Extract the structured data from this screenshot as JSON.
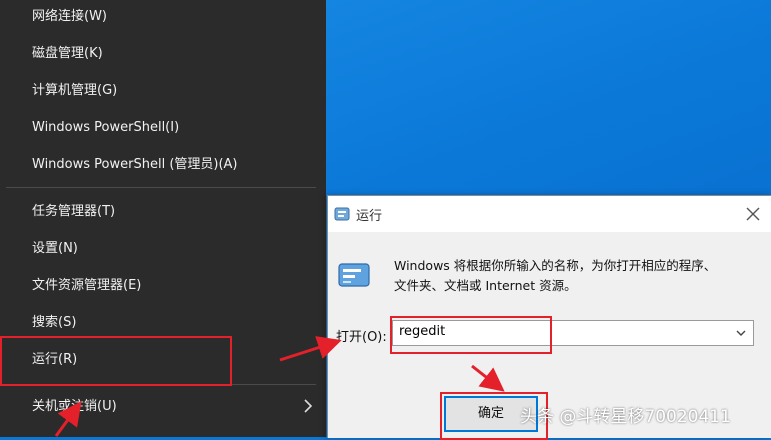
{
  "winx_menu": {
    "group1": [
      "网络连接(W)",
      "磁盘管理(K)",
      "计算机管理(G)",
      "Windows PowerShell(I)",
      "Windows PowerShell (管理员)(A)"
    ],
    "group2": [
      "任务管理器(T)",
      "设置(N)",
      "文件资源管理器(E)",
      "搜索(S)",
      "运行(R)"
    ],
    "group3": [
      "关机或注销(U)"
    ]
  },
  "run_dialog": {
    "title": "运行",
    "description_line1": "Windows 将根据你所输入的名称，为你打开相应的程序、",
    "description_line2": "文件夹、文档或 Internet 资源。",
    "open_label": "打开(O):",
    "open_value": "regedit",
    "ok_label": "确定"
  },
  "watermark": "头条 @斗转星移70020411",
  "colors": {
    "menu_bg": "#2b2b2b",
    "desktop_blue": "#0b78d8",
    "annotation_red": "#e4202a"
  }
}
